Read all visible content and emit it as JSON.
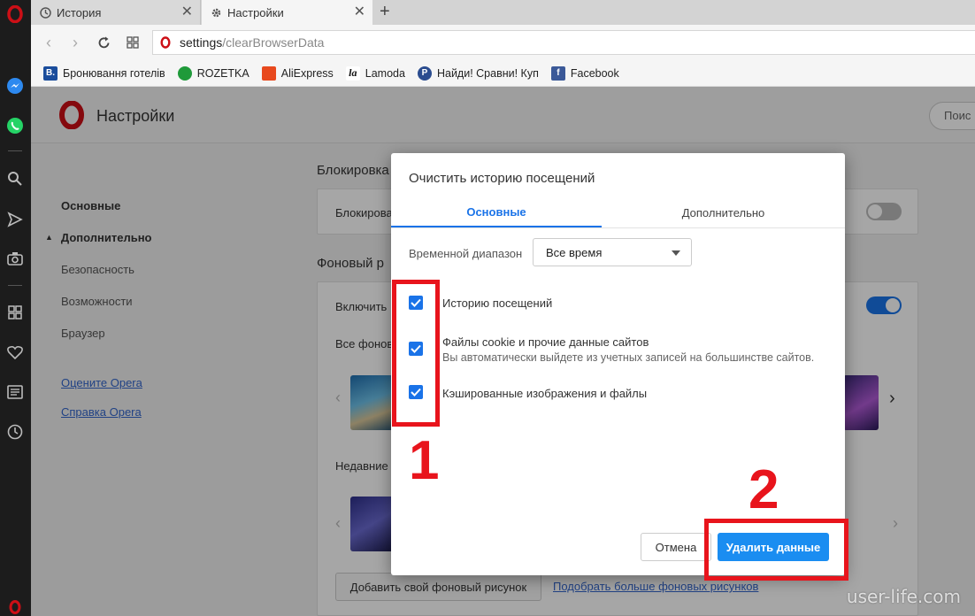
{
  "browser": {
    "tabs": [
      {
        "label": "История",
        "icon": "history-icon"
      },
      {
        "label": "Настройки",
        "icon": "gear-icon"
      }
    ],
    "address": {
      "scheme": "settings",
      "path": "/clearBrowserData"
    },
    "bookmarks": [
      {
        "label": "Бронювання готелів",
        "icon": "booking-icon",
        "color": "#1a4d9c",
        "letter": "B."
      },
      {
        "label": "ROZETKA",
        "icon": "rozetka-icon",
        "color": "#1f9a3a",
        "letter": ""
      },
      {
        "label": "AliExpress",
        "icon": "aliexpress-icon",
        "color": "#e8491d",
        "letter": ""
      },
      {
        "label": "Lamoda",
        "icon": "lamoda-icon",
        "color": "#111111",
        "letter": "la"
      },
      {
        "label": "Найди! Сравни! Куп",
        "icon": "price-icon",
        "color": "#2a4c8f",
        "letter": "P"
      },
      {
        "label": "Facebook",
        "icon": "facebook-icon",
        "color": "#3b5998",
        "letter": "f"
      }
    ]
  },
  "settings": {
    "title": "Настройки",
    "search_label": "Поис",
    "nav": {
      "basic": "Основные",
      "advanced": "Дополнительно",
      "security": "Безопасность",
      "features": "Возможности",
      "browser": "Браузер",
      "rate": "Оцените Opera",
      "help": "Справка Opera"
    },
    "sections": {
      "block_title": "Блокировка",
      "block_row": "Блокирова",
      "wallpaper_title": "Фоновый р",
      "enable_row": "Включить",
      "all_wallpapers": "Все фонов",
      "recent": "Недавние",
      "add_button": "Добавить свой фоновый рисунок",
      "more_link": "Подобрать больше фоновых рисунков"
    }
  },
  "dialog": {
    "title": "Очистить историю посещений",
    "tabs": {
      "basic": "Основные",
      "advanced": "Дополнительно"
    },
    "range_label": "Временной диапазон",
    "range_value": "Все время",
    "options": [
      {
        "label": "Историю посещений",
        "sub": ""
      },
      {
        "label": "Файлы cookie и прочие данные сайтов",
        "sub": "Вы автоматически выйдете из учетных записей на большинстве сайтов."
      },
      {
        "label": "Кэшированные изображения и файлы",
        "sub": ""
      }
    ],
    "cancel": "Отмена",
    "delete": "Удалить данные"
  },
  "annotations": {
    "one": "1",
    "two": "2"
  },
  "watermark": "user-life.com",
  "colors": {
    "accent": "#1a73e8",
    "annotation_red": "#e8141c",
    "opera_red": "#cc0f16"
  }
}
